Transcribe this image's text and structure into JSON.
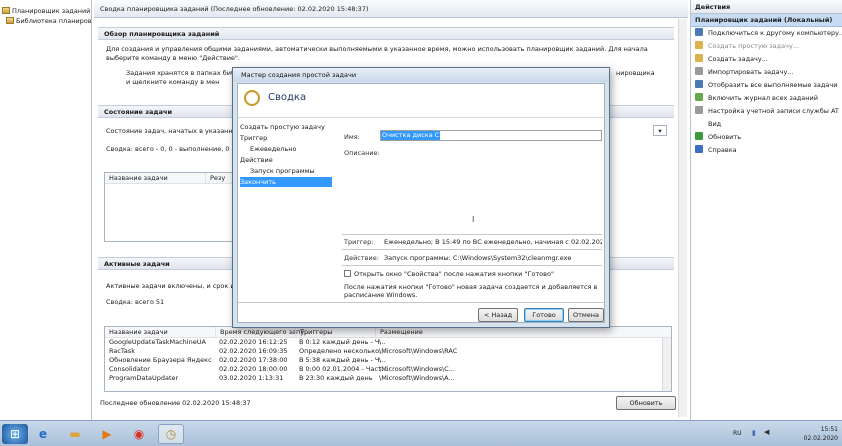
{
  "left_tree": {
    "items": [
      "Планировщик заданий (Локал",
      "Библиотека планировщ"
    ]
  },
  "center": {
    "title": "Сводка планировщика заданий (Последнее обновление: 02.02.2020 15:48:37)",
    "overview": {
      "header": "Обзор планировщика заданий",
      "text1": "Для создания и управления общими заданиями, автоматически выполняемыми в указанное время, можно использовать планировщик заданий. Для начала выберите команду в меню \"Действие\".",
      "text2a": "Задания хранятся в папках библи",
      "text2b": "нировщика",
      "text2c": "и щелкните команду в мен"
    },
    "status": {
      "header": "Состояние задачи",
      "line1": "Состояние задач, начатых в указанный пер",
      "line2": "Сводка: всего - 0, 0 - выполнение, 0 - успе",
      "col1": "Название задачи",
      "col2": "Резу"
    },
    "active": {
      "header": "Активные задачи",
      "line1": "Активные задачи включены, и срок их дей",
      "summary": "Сводка: всего 51",
      "columns": [
        "Название задачи",
        "Время следующего запу...",
        "Триггеры",
        "Размещение"
      ],
      "rows": [
        [
          "GoogleUpdateTaskMachineUA",
          "02.02.2020 16:12:25",
          "В 0:12 каждый день - Ч...",
          "\\"
        ],
        [
          "RacTask",
          "02.02.2020 16:09:35",
          "Определено несколько...",
          "\\Microsoft\\Windows\\RAC"
        ],
        [
          "Обновление Браузера Яндекс",
          "02.02.2020 17:38:00",
          "В 5:38 каждый день - Ч...",
          "\\"
        ],
        [
          "Consolidator",
          "02.02.2020 18:00:00",
          "В 0:00 02.01.2004 - Част...",
          "\\Microsoft\\Windows\\C..."
        ],
        [
          "ProgramDataUpdater",
          "03.02.2020 1:13:31",
          "В 23:30 каждый день",
          "\\Microsoft\\Windows\\A..."
        ]
      ]
    },
    "footer": "Последнее обновление 02.02.2020 15:48:37",
    "refresh_button": "Обновить"
  },
  "actions": {
    "header": "Действия",
    "subheader": "Планировщик заданий (Локальный)",
    "items": [
      {
        "label": "Подключиться к другому компьютеру...",
        "disabled": false,
        "color": "#4a7bb5"
      },
      {
        "label": "Создать простую задачу...",
        "disabled": true,
        "color": "#d9b44a"
      },
      {
        "label": "Создать задачу...",
        "disabled": false,
        "color": "#d9b44a"
      },
      {
        "label": "Импортировать задачу...",
        "disabled": false,
        "color": "#9a9a9a"
      },
      {
        "label": "Отобразить все выполняемые задачи",
        "disabled": false,
        "color": "#4a7bb5"
      },
      {
        "label": "Включить журнал всех заданий",
        "disabled": false,
        "color": "#6aa84f"
      },
      {
        "label": "Настройка учетной записи службы AT",
        "disabled": false,
        "color": "#9a9a9a"
      },
      {
        "label": "Вид",
        "disabled": false,
        "color": "#ffffff"
      },
      {
        "label": "Обновить",
        "disabled": false,
        "color": "#3c9a3c"
      },
      {
        "label": "Справка",
        "disabled": false,
        "color": "#3a6fc4"
      }
    ]
  },
  "wizard": {
    "title": "Мастер создания простой задачи",
    "header": "Сводка",
    "steps": [
      "Создать простую задачу",
      "Триггер",
      "Ежеведельно",
      "Действие",
      "Запуск программы",
      "Закончить"
    ],
    "name_label": "Имя:",
    "name_value": "Очистка диска С",
    "description_label": "Описание:",
    "trigger_label": "Триггер:",
    "trigger_value": "Еженедельно; В 15:49 по ВС еженедельно, начиная с 02.02.2020",
    "action_label": "Действие:",
    "action_value": "Запуск программы: C:\\Windows\\System32\\cleanmgr.exe",
    "checkbox_label": "Открыть окно \"Свойства\" после нажатия кнопки \"Готово\"",
    "note": "После нажатия кнопки \"Готово\" новая задача создается и добавляется в расписание Windows.",
    "back_button": "< Назад",
    "finish_button": "Готово",
    "cancel_button": "Отмена"
  },
  "taskbar": {
    "lang": "RU",
    "time": "15:51",
    "date": "02.02.2020"
  }
}
